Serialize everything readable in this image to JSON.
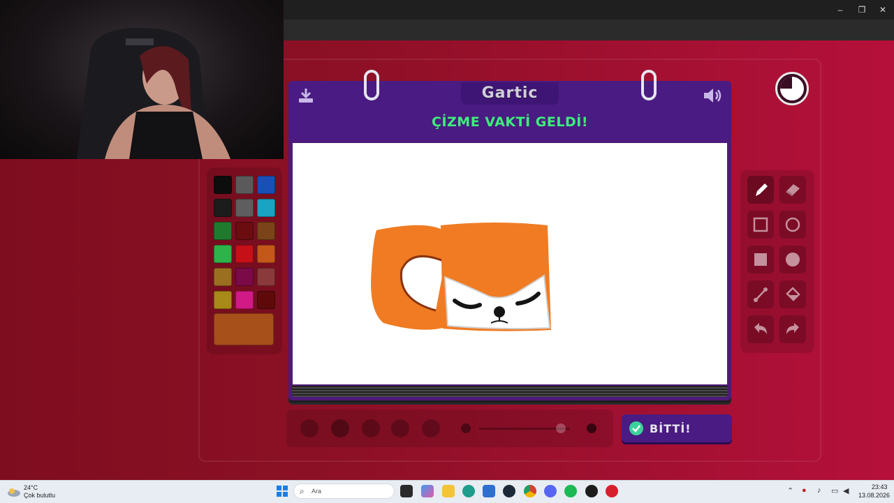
{
  "game": {
    "logo": "Gartic",
    "phase_title": "ÇİZME VAKTİ GELDİ!",
    "done_button": "BİTTİ!",
    "current_color": "#a8501a",
    "palette": [
      "#0d0d0d",
      "#5a5a5a",
      "#1a4fb8",
      "#1c1c1c",
      "#5e5e5e",
      "#1aa3c3",
      "#1f7a2e",
      "#6a0c10",
      "#7a4418",
      "#2db34a",
      "#c61018",
      "#c4581a",
      "#9a7020",
      "#7a0a48",
      "#8a3a3a",
      "#a88a18",
      "#d11a86",
      "#5e0a0a"
    ],
    "tools": [
      {
        "name": "pencil-tool",
        "icon": "pencil-icon",
        "active": true
      },
      {
        "name": "eraser-tool",
        "icon": "eraser-icon",
        "active": false
      },
      {
        "name": "rectangle-outline-tool",
        "icon": "square-outline-icon",
        "active": false
      },
      {
        "name": "ellipse-outline-tool",
        "icon": "circle-outline-icon",
        "active": false
      },
      {
        "name": "rectangle-fill-tool",
        "icon": "square-filled-icon",
        "active": false
      },
      {
        "name": "ellipse-fill-tool",
        "icon": "circle-filled-icon",
        "active": false
      },
      {
        "name": "line-tool",
        "icon": "line-icon",
        "active": false
      },
      {
        "name": "fill-bucket-tool",
        "icon": "bucket-icon",
        "active": false
      },
      {
        "name": "undo-tool",
        "icon": "undo-icon",
        "active": false
      },
      {
        "name": "redo-tool",
        "icon": "redo-icon",
        "active": false
      }
    ],
    "brush_size_level": 0.9
  },
  "taskbar": {
    "weather_temp": "24°C",
    "weather_desc": "Çok bulutlu",
    "search_placeholder": "Ara",
    "time": "23:43",
    "date": "13.08.2026"
  },
  "colors": {
    "accent_green": "#3df07a",
    "board_purple": "#4a1b82"
  }
}
